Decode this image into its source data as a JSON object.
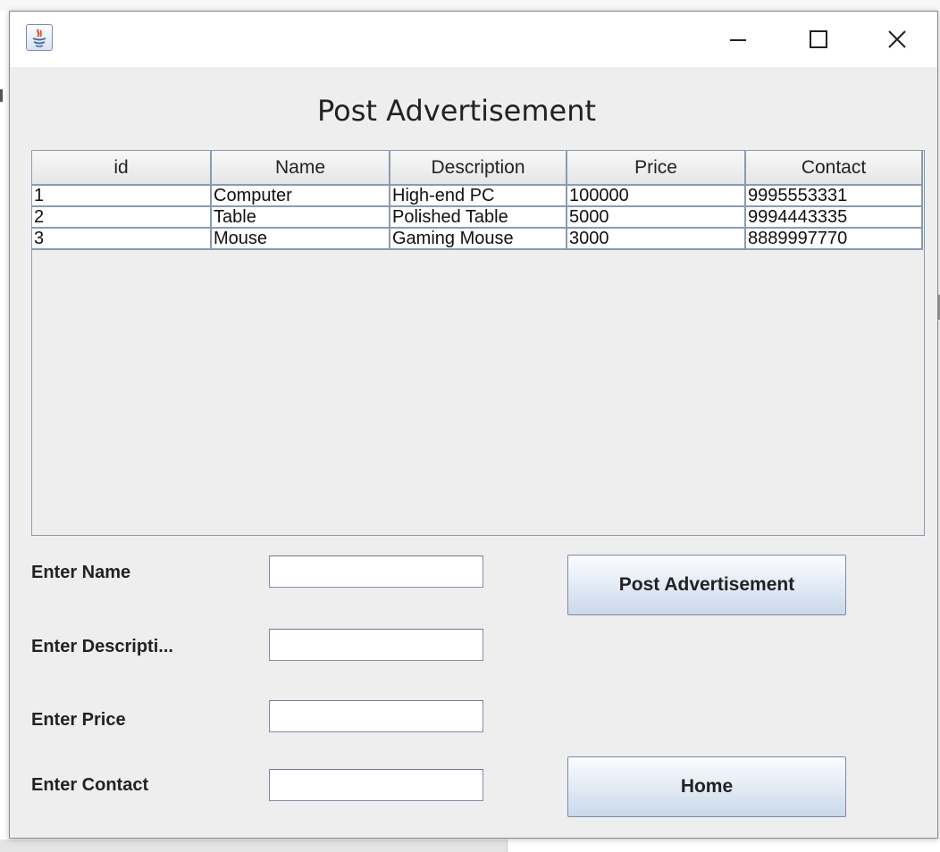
{
  "window": {
    "title": "",
    "controls": [
      "minimize-icon",
      "maximize-icon",
      "close-icon"
    ]
  },
  "page_title": "Post Advertisement",
  "table": {
    "columns": [
      "id",
      "Name",
      "Description",
      "Price",
      "Contact"
    ],
    "rows": [
      [
        "1",
        "Computer",
        "High-end PC",
        "100000",
        "9995553331"
      ],
      [
        "2",
        "Table",
        "Polished Table",
        "5000",
        "9994443335"
      ],
      [
        "3",
        "Mouse",
        "Gaming Mouse",
        "3000",
        "8889997770"
      ]
    ]
  },
  "form": {
    "name_label": "Enter Name",
    "description_label": "Enter Descripti...",
    "price_label": "Enter Price",
    "contact_label": "Enter Contact",
    "name_value": "",
    "description_value": "",
    "price_value": "",
    "contact_value": ""
  },
  "buttons": {
    "post_label": "Post Advertisement",
    "home_label": "Home"
  },
  "colors": {
    "window_bg": "#eeeeee",
    "grid_line": "#8a9bb0",
    "button_gradient_end": "#c9d8ea"
  }
}
